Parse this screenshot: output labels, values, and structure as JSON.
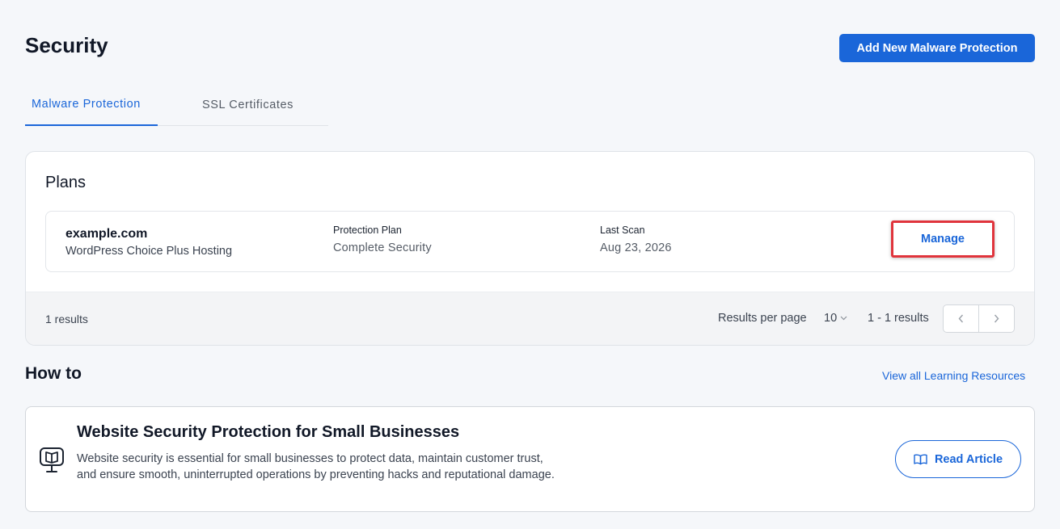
{
  "header": {
    "title": "Security",
    "add_button": "Add New Malware Protection"
  },
  "tabs": [
    {
      "label": "Malware Protection",
      "active": true
    },
    {
      "label": "SSL Certificates",
      "active": false
    }
  ],
  "plans": {
    "title": "Plans",
    "rows": [
      {
        "domain": "example.com",
        "hosting": "WordPress Choice Plus Hosting",
        "protection_plan_label": "Protection Plan",
        "protection_plan": "Complete Security",
        "last_scan_label": "Last Scan",
        "last_scan": "Aug 23, 2026",
        "action": "Manage"
      }
    ],
    "footer": {
      "results_count": "1 results",
      "results_per_page_label": "Results per page",
      "results_per_page": "10",
      "range": "1 - 1 results"
    }
  },
  "howto": {
    "title": "How to",
    "link": "View all Learning Resources",
    "article": {
      "title": "Website Security Protection for Small Businesses",
      "description": "Website security is essential for small businesses to protect data, maintain customer trust, and ensure smooth, uninterrupted operations by preventing hacks and reputational damage.",
      "button": "Read Article",
      "icon": "monitor-book-icon"
    }
  },
  "colors": {
    "accent": "#1a66d9",
    "highlight": "#e0343c",
    "background": "#f5f7fa"
  }
}
